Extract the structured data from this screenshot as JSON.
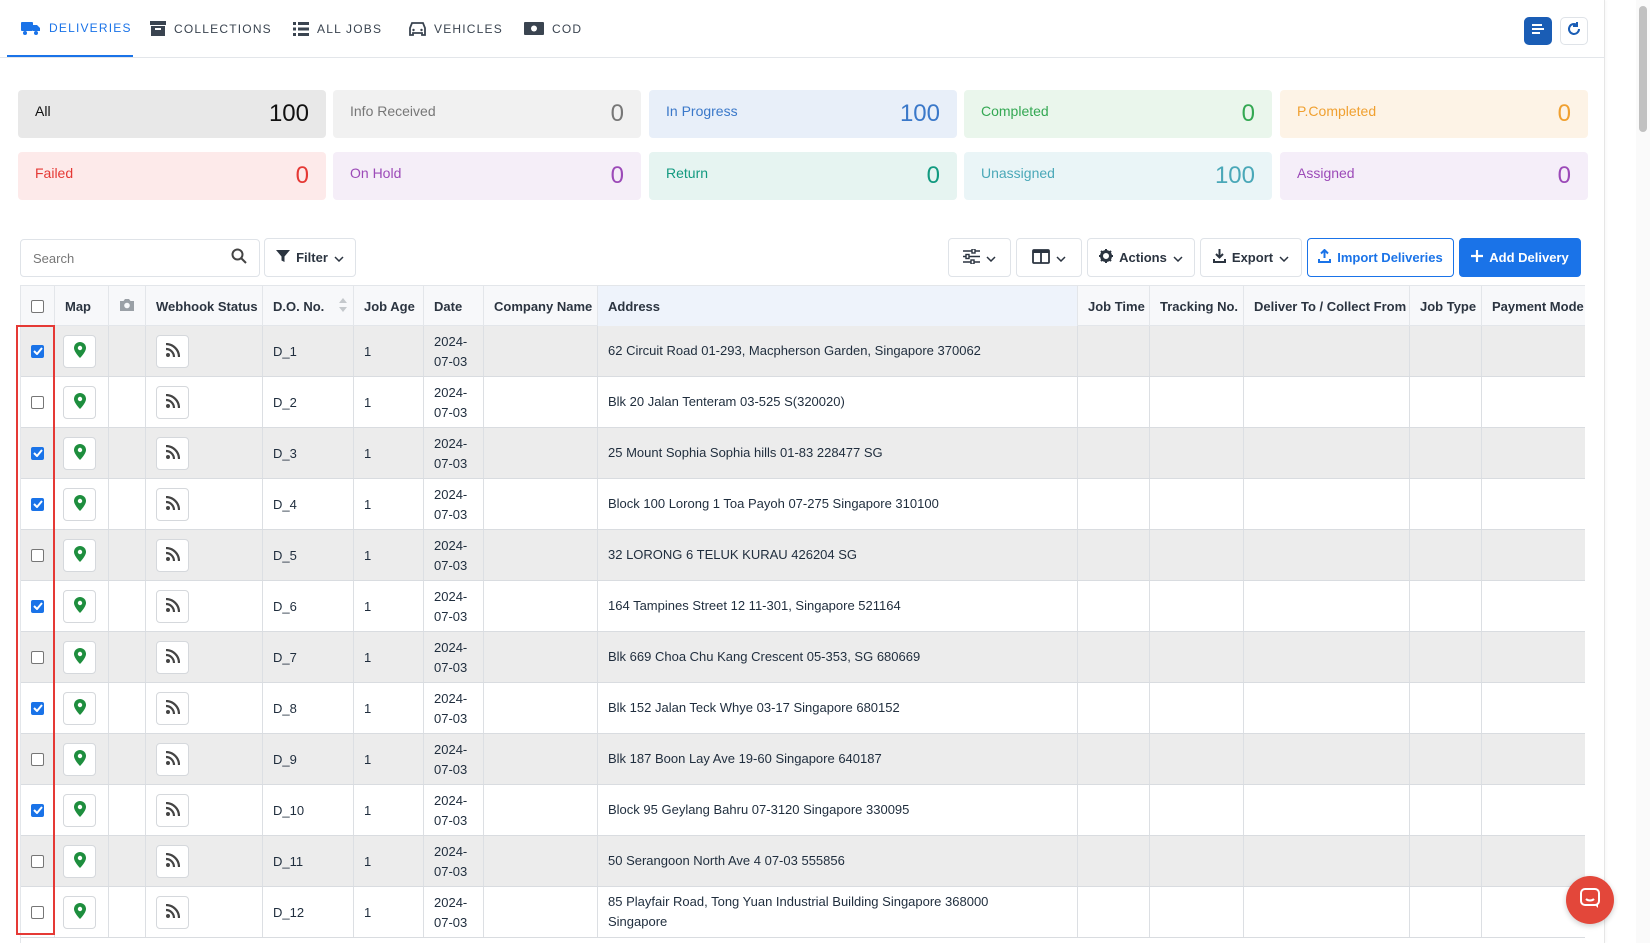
{
  "nav": {
    "tabs": [
      {
        "label": "DELIVERIES",
        "icon": "truck-icon",
        "active": true
      },
      {
        "label": "COLLECTIONS",
        "icon": "archive-box-icon",
        "active": false
      },
      {
        "label": "ALL JOBS",
        "icon": "list-icon",
        "active": false
      },
      {
        "label": "VEHICLES",
        "icon": "car-icon",
        "active": false
      },
      {
        "label": "COD",
        "icon": "cash-icon",
        "active": false
      }
    ],
    "right_buttons": [
      "document-list-icon",
      "refresh-icon"
    ]
  },
  "status_cards": [
    {
      "label": "All",
      "count": "100",
      "bg": "#e8e8e8",
      "color": "#111111"
    },
    {
      "label": "Info Received",
      "count": "0",
      "bg": "#f1f1f1",
      "color": "#777777"
    },
    {
      "label": "In Progress",
      "count": "100",
      "bg": "#e8eff9",
      "color": "#3a78c9"
    },
    {
      "label": "Completed",
      "count": "0",
      "bg": "#eaf6ec",
      "color": "#34a853"
    },
    {
      "label": "P.Completed",
      "count": "0",
      "bg": "#fdf3e6",
      "color": "#f0a030"
    },
    {
      "label": "Failed",
      "count": "0",
      "bg": "#fdeaea",
      "color": "#e53935"
    },
    {
      "label": "On Hold",
      "count": "0",
      "bg": "#f5eef8",
      "color": "#9c4ab8"
    },
    {
      "label": "Return",
      "count": "0",
      "bg": "#e6f4f1",
      "color": "#129a80"
    },
    {
      "label": "Unassigned",
      "count": "100",
      "bg": "#eaf5f7",
      "color": "#4aa8b8"
    },
    {
      "label": "Assigned",
      "count": "0",
      "bg": "#f5eef9",
      "color": "#9c4ab8"
    }
  ],
  "toolbar": {
    "search_placeholder": "Search",
    "filter_label": "Filter",
    "actions_label": "Actions",
    "export_label": "Export",
    "import_label": "Import Deliveries",
    "add_label": "Add Delivery"
  },
  "table": {
    "columns": [
      "Map",
      "Webhook Status",
      "D.O. No.",
      "Job Age",
      "Date",
      "Company Name",
      "Address",
      "Job Time",
      "Tracking No.",
      "Deliver To / Collect From",
      "Job Type",
      "Payment Mode"
    ],
    "rows": [
      {
        "checked": true,
        "do_no": "D_1",
        "job_age": "1",
        "date1": "2024-",
        "date2": "07-03",
        "address": "62 Circuit Road 01-293, Macpherson Garden, Singapore 370062"
      },
      {
        "checked": false,
        "do_no": "D_2",
        "job_age": "1",
        "date1": "2024-",
        "date2": "07-03",
        "address": "Blk 20 Jalan Tenteram 03-525 S(320020)"
      },
      {
        "checked": true,
        "do_no": "D_3",
        "job_age": "1",
        "date1": "2024-",
        "date2": "07-03",
        "address": "25 Mount Sophia Sophia hills 01-83 228477 SG"
      },
      {
        "checked": true,
        "do_no": "D_4",
        "job_age": "1",
        "date1": "2024-",
        "date2": "07-03",
        "address": "Block 100 Lorong 1 Toa Payoh 07-275 Singapore 310100"
      },
      {
        "checked": false,
        "do_no": "D_5",
        "job_age": "1",
        "date1": "2024-",
        "date2": "07-03",
        "address": "32 LORONG 6 TELUK KURAU 426204 SG"
      },
      {
        "checked": true,
        "do_no": "D_6",
        "job_age": "1",
        "date1": "2024-",
        "date2": "07-03",
        "address": "164 Tampines Street 12 11-301, Singapore 521164"
      },
      {
        "checked": false,
        "do_no": "D_7",
        "job_age": "1",
        "date1": "2024-",
        "date2": "07-03",
        "address": "Blk 669 Choa Chu Kang Crescent 05-353, SG 680669"
      },
      {
        "checked": true,
        "do_no": "D_8",
        "job_age": "1",
        "date1": "2024-",
        "date2": "07-03",
        "address": "Blk 152 Jalan Teck Whye 03-17 Singapore 680152"
      },
      {
        "checked": false,
        "do_no": "D_9",
        "job_age": "1",
        "date1": "2024-",
        "date2": "07-03",
        "address": "Blk 187 Boon Lay Ave 19-60 Singapore 640187"
      },
      {
        "checked": true,
        "do_no": "D_10",
        "job_age": "1",
        "date1": "2024-",
        "date2": "07-03",
        "address": "Block 95 Geylang Bahru 07-3120 Singapore 330095"
      },
      {
        "checked": false,
        "do_no": "D_11",
        "job_age": "1",
        "date1": "2024-",
        "date2": "07-03",
        "address": "50 Serangoon North Ave 4 07-03 555856"
      },
      {
        "checked": false,
        "do_no": "D_12",
        "job_age": "1",
        "date1": "2024-",
        "date2": "07-03",
        "address": "85 Playfair Road, Tong Yuan Industrial Building Singapore 368000 Singapore"
      }
    ]
  },
  "colors": {
    "accent": "#1a73e8",
    "map_pin": "#1e8e3e",
    "highlight": "#e53935",
    "chat": "#e3473a"
  }
}
